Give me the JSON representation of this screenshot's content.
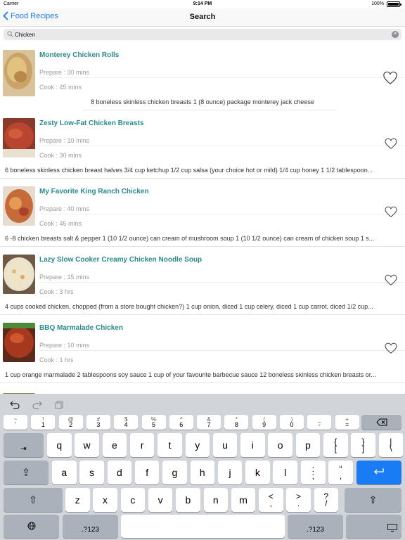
{
  "status_bar": {
    "carrier": "Carrier",
    "time": "9:14 PM",
    "battery": "100%"
  },
  "nav": {
    "back_label": "Food Recipes",
    "title": "Search"
  },
  "search": {
    "value": "Chicken"
  },
  "recipes": [
    {
      "name": "Monterey Chicken Rolls",
      "prepare": "Prepare : 30 mins",
      "cook": "Cook : 45 mins",
      "ingredients": "8 boneless skinless chicken breasts  1 (8 ounce) package monterey jack cheese"
    },
    {
      "name": "Zesty Low-Fat Chicken Breasts",
      "prepare": "Prepare : 10 mins",
      "cook": "Cook : 30 mins",
      "ingredients": "6 boneless skinless chicken breast halves  3/4 cup ketchup  1/2 cup salsa (your choice hot or mild)  1/4 cup honey  1 1/2 tablespoon..."
    },
    {
      "name": "My Favorite King Ranch Chicken",
      "prepare": "Prepare : 40 mins",
      "cook": "Cook : 45 mins",
      "ingredients": "6 -8 chicken breasts  salt & pepper  1 (10 1/2 ounce) can cream of mushroom soup  1 (10 1/2 ounce) can cream of chicken soup  1 s..."
    },
    {
      "name": "Lazy Slow Cooker Creamy Chicken Noodle Soup",
      "prepare": "Prepare : 15 mins",
      "cook": "Cook : 3 hrs",
      "ingredients": "4 cups cooked chicken, chopped (from a store bought chicken?)  1 cup onion, diced  1 cup celery, diced  1 cup carrot, diced  1/2 cup..."
    },
    {
      "name": "BBQ Marmalade Chicken",
      "prepare": "Prepare : 10 mins",
      "cook": "Cook : 1 hrs",
      "ingredients": "1 cup orange marmalade  2 tablespoons soy sauce  1 cup of your favourite barbecue sauce  12 boneless skinless chicken breasts or..."
    }
  ],
  "keyboard": {
    "number_row": [
      {
        "sec": "~",
        "pri": "`"
      },
      {
        "sec": "!",
        "pri": "1"
      },
      {
        "sec": "@",
        "pri": "2"
      },
      {
        "sec": "#",
        "pri": "3"
      },
      {
        "sec": "$",
        "pri": "4"
      },
      {
        "sec": "%",
        "pri": "5"
      },
      {
        "sec": "^",
        "pri": "6"
      },
      {
        "sec": "&",
        "pri": "7"
      },
      {
        "sec": "*",
        "pri": "8"
      },
      {
        "sec": "(",
        "pri": "9"
      },
      {
        "sec": ")",
        "pri": "0"
      },
      {
        "sec": "_",
        "pri": "-"
      },
      {
        "sec": "+",
        "pri": "="
      }
    ],
    "row1": [
      "q",
      "w",
      "e",
      "r",
      "t",
      "y",
      "u",
      "i",
      "o",
      "p"
    ],
    "row1_extra": [
      {
        "top": "{",
        "bot": "["
      },
      {
        "top": "}",
        "bot": "]"
      },
      {
        "top": "|",
        "bot": "\\"
      }
    ],
    "row2": [
      "a",
      "s",
      "d",
      "f",
      "g",
      "h",
      "j",
      "k",
      "l"
    ],
    "row2_extra": [
      {
        "top": ":",
        "bot": ";"
      },
      {
        "top": "“",
        "bot": ","
      }
    ],
    "row3": [
      "z",
      "x",
      "c",
      "v",
      "b",
      "n",
      "m"
    ],
    "row3_extra": [
      {
        "top": "<",
        "bot": ","
      },
      {
        "top": ">",
        "bot": "."
      },
      {
        "top": "?",
        "bot": "/"
      }
    ],
    "numbers_label": ".?123"
  },
  "colors": {
    "accent": "#1d7cf2",
    "recipe_title": "#2a8a8a",
    "muted": "#9a9a9a"
  }
}
